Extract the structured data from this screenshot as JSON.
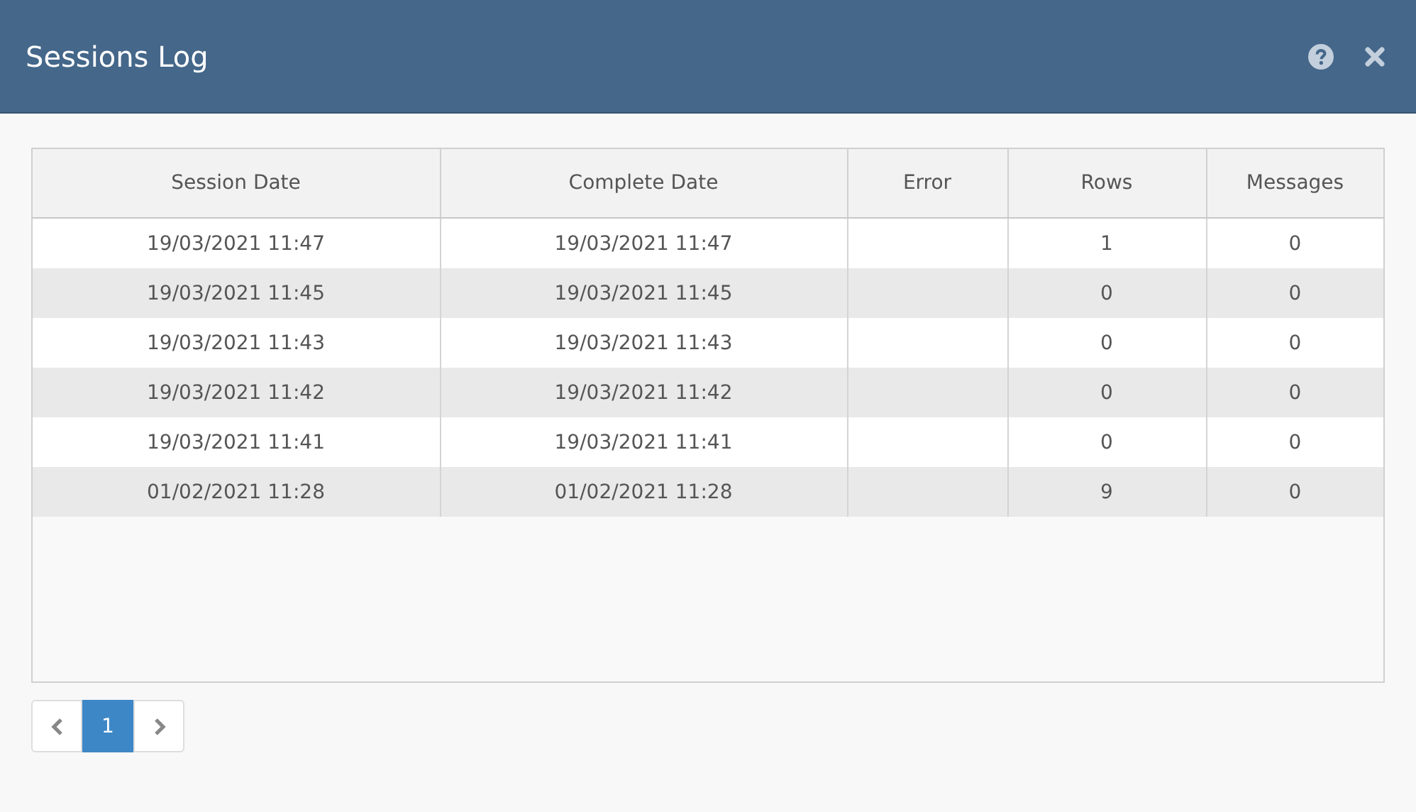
{
  "window": {
    "title": "Sessions Log"
  },
  "table": {
    "columns": [
      "Session Date",
      "Complete Date",
      "Error",
      "Rows",
      "Messages"
    ],
    "rows": [
      [
        "19/03/2021 11:47",
        "19/03/2021 11:47",
        "",
        "1",
        "0"
      ],
      [
        "19/03/2021 11:45",
        "19/03/2021 11:45",
        "",
        "0",
        "0"
      ],
      [
        "19/03/2021 11:43",
        "19/03/2021 11:43",
        "",
        "0",
        "0"
      ],
      [
        "19/03/2021 11:42",
        "19/03/2021 11:42",
        "",
        "0",
        "0"
      ],
      [
        "19/03/2021 11:41",
        "19/03/2021 11:41",
        "",
        "0",
        "0"
      ],
      [
        "01/02/2021 11:28",
        "01/02/2021 11:28",
        "",
        "9",
        "0"
      ]
    ]
  },
  "pagination": {
    "pages": [
      {
        "label": "1",
        "selected": true
      }
    ]
  }
}
